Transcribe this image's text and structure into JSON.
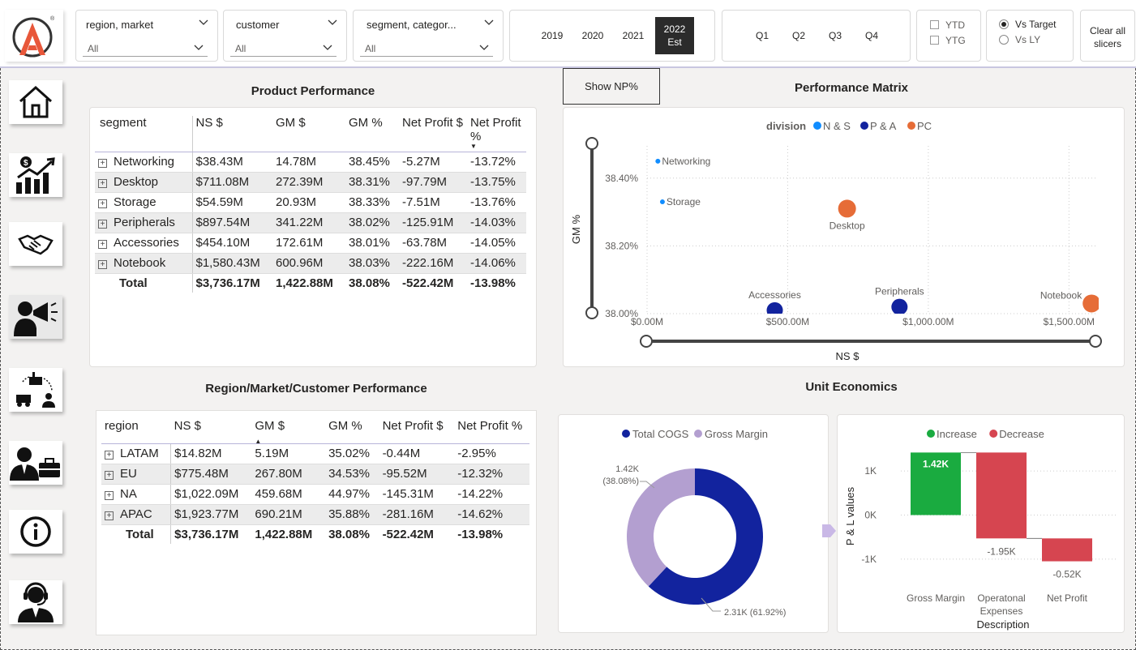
{
  "slicers": {
    "region": {
      "title": "region, market",
      "value": "All"
    },
    "customer": {
      "title": "customer",
      "value": "All"
    },
    "segment": {
      "title": "segment, categor...",
      "value": "All"
    }
  },
  "years": {
    "y2019": "2019",
    "y2020": "2020",
    "y2021": "2021",
    "y2022": "2022",
    "y2022_sub": "Est"
  },
  "quarters": [
    "Q1",
    "Q2",
    "Q3",
    "Q4"
  ],
  "periods": {
    "ytd": "YTD",
    "ytg": "YTG"
  },
  "compare": {
    "vs_target": "Vs Target",
    "vs_ly": "Vs LY",
    "selected": "Vs Target"
  },
  "clear_slicers": {
    "line1": "Clear all",
    "line2": "slicers"
  },
  "nav": [
    "home-icon",
    "growth-chart-icon",
    "handshake-icon",
    "megaphone-person-icon",
    "supply-chain-icon",
    "executive-icon",
    "info-icon",
    "support-agent-icon"
  ],
  "product_performance": {
    "title": "Product Performance",
    "headers": [
      "segment",
      "NS $",
      "GM $",
      "GM %",
      "Net Profit $",
      "Net Profit %"
    ],
    "rows": [
      [
        "Networking",
        "$38.43M",
        "14.78M",
        "38.45%",
        "-5.27M",
        "-13.72%"
      ],
      [
        "Desktop",
        "$711.08M",
        "272.39M",
        "38.31%",
        "-97.79M",
        "-13.75%"
      ],
      [
        "Storage",
        "$54.59M",
        "20.93M",
        "38.33%",
        "-7.51M",
        "-13.76%"
      ],
      [
        "Peripherals",
        "$897.54M",
        "341.22M",
        "38.02%",
        "-125.91M",
        "-14.03%"
      ],
      [
        "Accessories",
        "$454.10M",
        "172.61M",
        "38.01%",
        "-63.78M",
        "-14.05%"
      ],
      [
        "Notebook",
        "$1,580.43M",
        "600.96M",
        "38.03%",
        "-222.16M",
        "-14.06%"
      ]
    ],
    "total": [
      "Total",
      "$3,736.17M",
      "1,422.88M",
      "38.08%",
      "-522.42M",
      "-13.98%"
    ]
  },
  "region_performance": {
    "title": "Region/Market/Customer Performance",
    "headers": [
      "region",
      "NS $",
      "GM $",
      "GM %",
      "Net Profit $",
      "Net Profit %"
    ],
    "rows": [
      [
        "LATAM",
        "$14.82M",
        "5.19M",
        "35.02%",
        "-0.44M",
        "-2.95%"
      ],
      [
        "EU",
        "$775.48M",
        "267.80M",
        "34.53%",
        "-95.52M",
        "-12.32%"
      ],
      [
        "NA",
        "$1,022.09M",
        "459.68M",
        "44.97%",
        "-145.31M",
        "-14.22%"
      ],
      [
        "APAC",
        "$1,923.77M",
        "690.21M",
        "35.88%",
        "-281.16M",
        "-14.62%"
      ]
    ],
    "total": [
      "Total",
      "$3,736.17M",
      "1,422.88M",
      "38.08%",
      "-522.42M",
      "-13.98%"
    ]
  },
  "show_np_button": "Show NP%",
  "performance_matrix": {
    "title": "Performance Matrix"
  },
  "unit_economics": {
    "title": "Unit Economics"
  },
  "chart_data": [
    {
      "type": "scatter",
      "title": "Performance Matrix",
      "xlabel": "NS $",
      "ylabel": "GM %",
      "legend_title": "division",
      "legend": [
        "N & S",
        "P & A",
        "PC"
      ],
      "colors": {
        "N & S": "#118dff",
        "P & A": "#12239e",
        "PC": "#e66c37"
      },
      "x_ticks": [
        "$0.00M",
        "$500.00M",
        "$1,000.00M",
        "$1,500.00M"
      ],
      "y_ticks": [
        "38.00%",
        "38.20%",
        "38.40%"
      ],
      "xlim": [
        0,
        1600
      ],
      "ylim": [
        38.0,
        38.5
      ],
      "points": [
        {
          "label": "Networking",
          "division": "N & S",
          "x": 38.43,
          "y": 38.45
        },
        {
          "label": "Storage",
          "division": "N & S",
          "x": 54.59,
          "y": 38.33
        },
        {
          "label": "Desktop",
          "division": "PC",
          "x": 711.08,
          "y": 38.31
        },
        {
          "label": "Accessories",
          "division": "P & A",
          "x": 454.1,
          "y": 38.01
        },
        {
          "label": "Peripherals",
          "division": "P & A",
          "x": 897.54,
          "y": 38.02
        },
        {
          "label": "Notebook",
          "division": "PC",
          "x": 1580.43,
          "y": 38.03
        }
      ]
    },
    {
      "type": "pie",
      "legend": [
        "Total COGS",
        "Gross Margin"
      ],
      "colors": {
        "Total COGS": "#12239e",
        "Gross Margin": "#b39fd0"
      },
      "slices": [
        {
          "name": "Total COGS",
          "value": 2.31,
          "label": "2.31K (61.92%)"
        },
        {
          "name": "Gross Margin",
          "value": 1.42,
          "label_line1": "1.42K",
          "label_line2": "(38.08%)"
        }
      ]
    },
    {
      "type": "bar",
      "subtype": "waterfall",
      "legend": [
        "Increase",
        "Decrease"
      ],
      "colors": {
        "Increase": "#1aab40",
        "Decrease": "#d64550"
      },
      "xlabel": "Description",
      "ylabel": "P & L values",
      "y_ticks": [
        "1K",
        "0K",
        "-1K"
      ],
      "ylim": [
        -1.5,
        1.5
      ],
      "categories": [
        "Gross Margin",
        "Operatonal Expenses",
        "Net Profit"
      ],
      "category_lines": [
        [
          "Gross Margin"
        ],
        [
          "Operatonal",
          "Expenses"
        ],
        [
          "Net Profit"
        ]
      ],
      "values": [
        1.42,
        -1.95,
        -0.52
      ],
      "labels": [
        "1.42K",
        "-1.95K",
        "-0.52K"
      ]
    }
  ]
}
